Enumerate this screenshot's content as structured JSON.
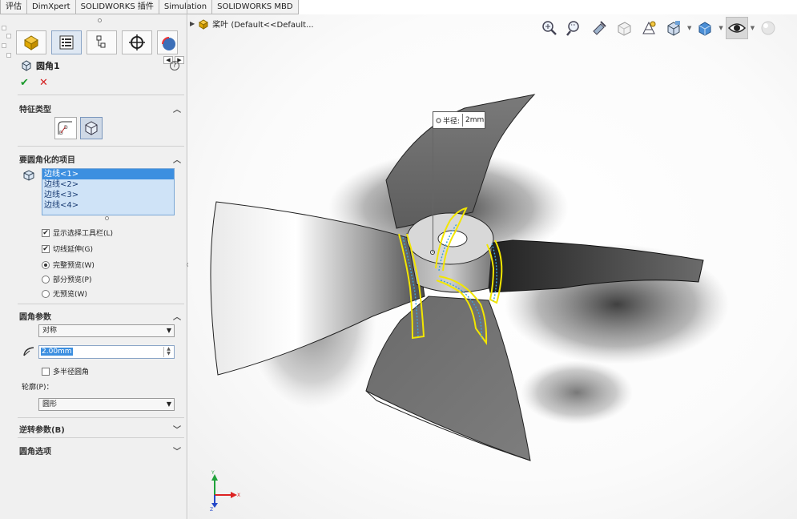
{
  "tabs": [
    "评估",
    "DimXpert",
    "SOLIDWORKS 插件",
    "Simulation",
    "SOLIDWORKS MBD"
  ],
  "feature": {
    "title": "圆角1",
    "help": "?",
    "ok": "✔",
    "cancel": "✕"
  },
  "sections": {
    "feature_type": "特征类型",
    "items_to_fillet": "要圆角化的项目",
    "fillet_params": "圆角参数",
    "profile_label": "轮廓(P)：",
    "setback": "逆转参数(B)",
    "fillet_options": "圆角选项"
  },
  "edges": [
    "边线<1>",
    "边线<2>",
    "边线<3>",
    "边线<4>"
  ],
  "options": {
    "show_toolbar": "显示选择工具栏(L)",
    "tangent_prop": "切线延伸(G)",
    "full_preview": "完整预览(W)",
    "partial_preview": "部分预览(P)",
    "no_preview": "无预览(W)",
    "multi_radius": "多半径圆角"
  },
  "params": {
    "symmetry": "对称",
    "radius": "2.00mm",
    "profile": "圆形"
  },
  "viewport": {
    "tree_label": "桨叶  (Default<<Default...",
    "callout_label": "半径:",
    "callout_value": "2mm"
  },
  "triad": {
    "x": "X",
    "y": "Y",
    "z": "Z"
  },
  "colors": {
    "highlight": "#f2e600",
    "preview": "#3fa0d9",
    "selection": "#3c8fe0"
  }
}
